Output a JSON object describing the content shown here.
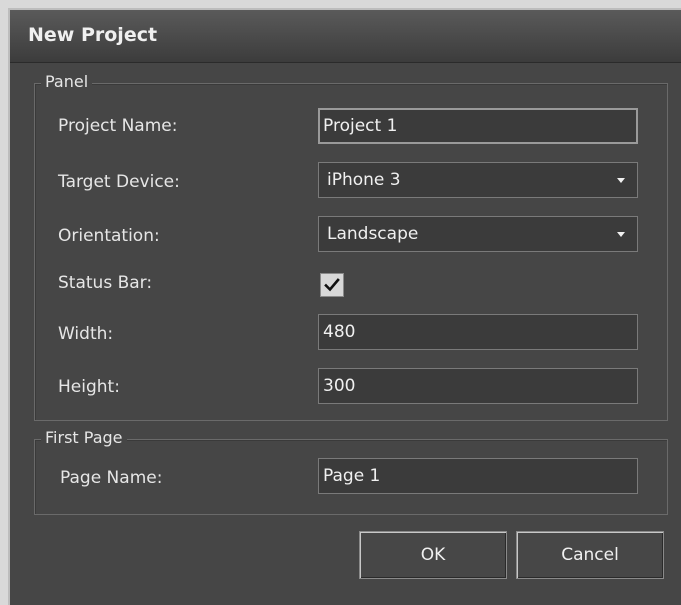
{
  "dialog": {
    "title": "New Project"
  },
  "panel": {
    "legend": "Panel",
    "project_name": {
      "label": "Project Name:",
      "value": "Project 1"
    },
    "target_device": {
      "label": "Target Device:",
      "value": "iPhone 3"
    },
    "orientation": {
      "label": "Orientation:",
      "value": "Landscape"
    },
    "status_bar": {
      "label": "Status Bar:",
      "checked": true
    },
    "width": {
      "label": "Width:",
      "value": "480"
    },
    "height": {
      "label": "Height:",
      "value": "300"
    }
  },
  "first_page": {
    "legend": "First Page",
    "page_name": {
      "label": "Page Name:",
      "value": "Page 1"
    }
  },
  "buttons": {
    "ok": "OK",
    "cancel": "Cancel"
  },
  "icons": {
    "dropdown": "chevron-down-icon",
    "checkmark": "checkmark-icon"
  }
}
